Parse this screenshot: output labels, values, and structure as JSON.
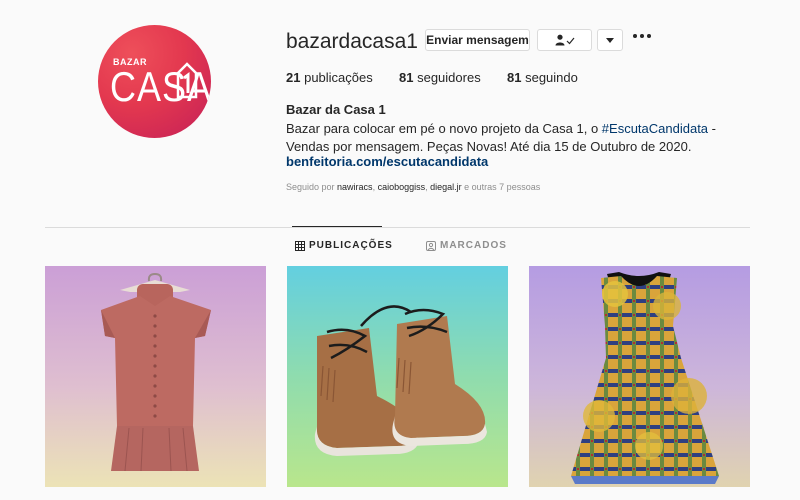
{
  "profile": {
    "avatar_small_text": "BAZAR",
    "avatar_big_text": "CASA",
    "avatar_house_number": "1",
    "username": "bazardacasa1",
    "message_button": "Enviar mensagem",
    "follow_icon": "person-check-icon",
    "dropdown_icon": "triangle-down-icon",
    "more_icon": "more-dots-icon"
  },
  "stats": {
    "posts_count": "21",
    "posts_label": "publicações",
    "followers_count": "81",
    "followers_label": "seguidores",
    "following_count": "81",
    "following_label": "seguindo"
  },
  "bio": {
    "name": "Bazar da Casa 1",
    "text_before": "Bazar para colocar em pé o novo projeto da Casa 1, o ",
    "hashtag": "#EscutaCandidata",
    "text_after": " - Vendas por mensagem. Peças Novas! Até dia 15 de Outubro de 2020.",
    "link": "benfeitoria.com/escutacandidata"
  },
  "followed_by": {
    "prefix": "Seguido por ",
    "user1": "nawiracs",
    "user2": "caioboggiss",
    "user3": "diegal.jr",
    "suffix": " e outras 7 pessoas"
  },
  "tabs": [
    {
      "label": "PUBLICAÇÕES",
      "icon": "grid-icon",
      "active": true
    },
    {
      "label": "MARCADOS",
      "icon": "tag-person-icon",
      "active": false
    }
  ],
  "posts": [
    {
      "subject": "pink-sleeveless-blouse"
    },
    {
      "subject": "suede-fringe-moccasin-boots"
    },
    {
      "subject": "plaid-floral-dress"
    }
  ],
  "colors": {
    "avatar": "#e3384f",
    "link": "#00376b",
    "muted": "#8e8e8e",
    "text": "#262626"
  }
}
